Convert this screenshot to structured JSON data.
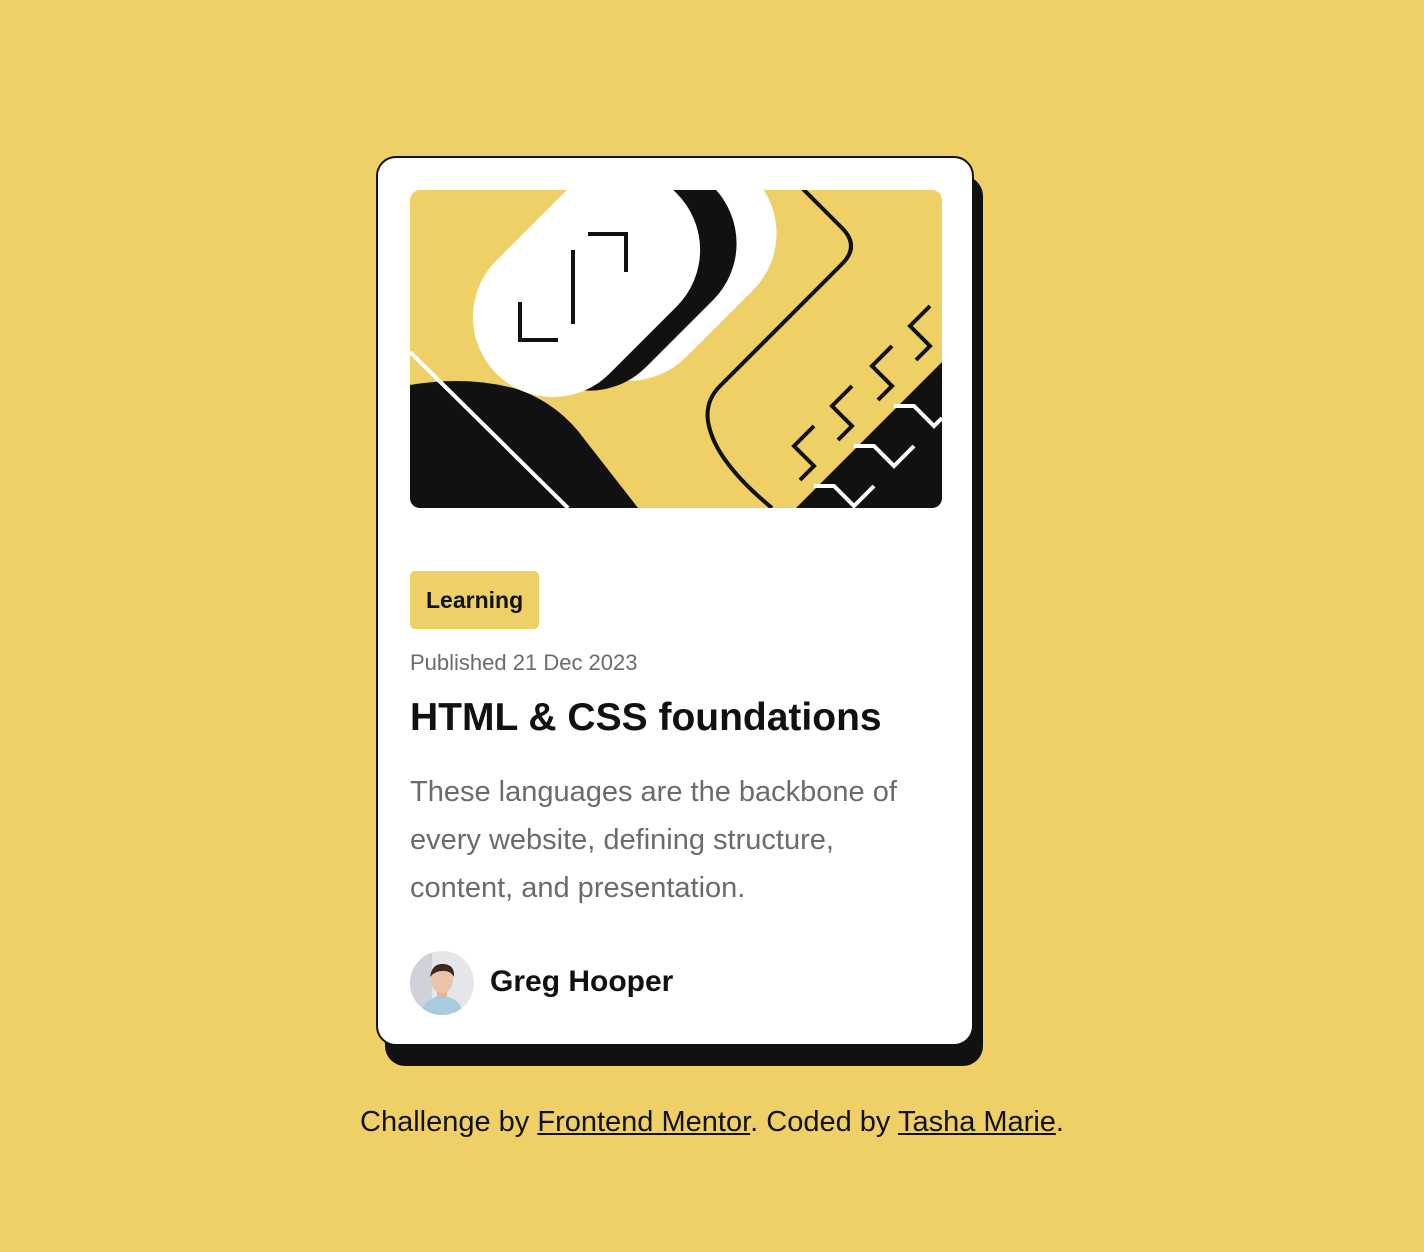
{
  "card": {
    "category": "Learning",
    "published": "Published 21 Dec 2023",
    "title": "HTML & CSS foundations",
    "description": "These languages are the backbone of every website, defining structure, content, and presentation.",
    "author": {
      "name": "Greg Hooper"
    }
  },
  "footer": {
    "prefix": "Challenge by ",
    "link1": "Frontend Mentor",
    "middle": ". Coded by ",
    "link2": "Tasha Marie",
    "suffix": "."
  },
  "colors": {
    "background": "#EED066",
    "card": "#FFFFFF",
    "ink": "#111111",
    "muted": "#6B6B6B"
  },
  "icons": [
    "illustration-article",
    "avatar-photo"
  ]
}
